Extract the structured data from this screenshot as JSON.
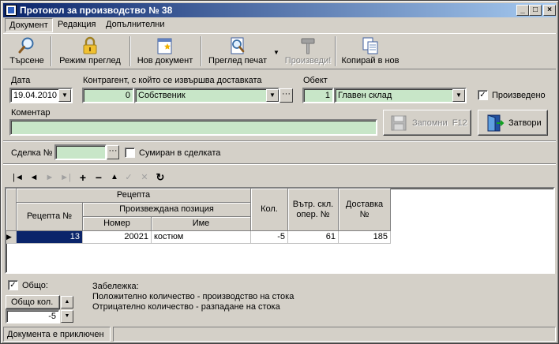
{
  "window": {
    "title": "Протокол за производство № 38",
    "controls": {
      "minimize": "_",
      "maximize": "□",
      "close": "×"
    }
  },
  "menu": [
    "Документ",
    "Редакция",
    "Допълнителни"
  ],
  "toolbar": {
    "search": "Търсене",
    "view_mode": "Режим преглед",
    "new_document": "Нов документ",
    "print_preview": "Преглед печат",
    "produce": "Произведи!",
    "copy_to_new": "Копирай в нов"
  },
  "form": {
    "date_label": "Дата",
    "date_value": "19.04.2010",
    "contractor_label": "Контрагент, с който се извършва доставката",
    "contractor_code": "0",
    "contractor_name": "Собственик",
    "object_label": "Обект",
    "object_code": "1",
    "object_name": "Главен склад",
    "produced_label": "Произведено",
    "produced_checked": true,
    "comment_label": "Коментар",
    "comment_value": "",
    "save_button": "Запомни  F12",
    "close_button": "Затвори"
  },
  "deal": {
    "label": "Сделка №",
    "value": "",
    "summed_label": "Сумиран в сделката",
    "summed_checked": false,
    "ellipsis": "..."
  },
  "navigator": {
    "buttons": [
      "first",
      "prior",
      "next",
      "last",
      "insert",
      "delete",
      "edit",
      "post",
      "cancel",
      "refresh"
    ],
    "glyphs": {
      "first": "|◄",
      "prior": "◄",
      "next": "►",
      "last": "►|",
      "insert": "+",
      "delete": "−",
      "edit": "▲",
      "post": "✓",
      "cancel": "✕",
      "refresh": "↻"
    }
  },
  "grid": {
    "headers": {
      "recipe_group": "Рецепта",
      "recipe_no": "Рецепта №",
      "produced_item": "Произвеждана позиция",
      "number": "Номер",
      "name": "Име",
      "qty": "Кол.",
      "internal_op": "Вътр. скл. опер. №",
      "delivery": "Доставка №"
    },
    "rows": [
      {
        "recipe_no": "13",
        "number": "20021",
        "name": "костюм",
        "qty": "-5",
        "internal_op": "61",
        "delivery": "185"
      }
    ]
  },
  "footer": {
    "total_label": "Общо:",
    "total_checked": true,
    "total_qty_label": "Общо кол.",
    "total_qty_value": "-5",
    "note_title": "Забележка:",
    "note_line1": "Положително количество - производство на стока",
    "note_line2": "Отрицателно количество - разпадане на стока"
  },
  "status": {
    "text": "Документа е приключен"
  }
}
